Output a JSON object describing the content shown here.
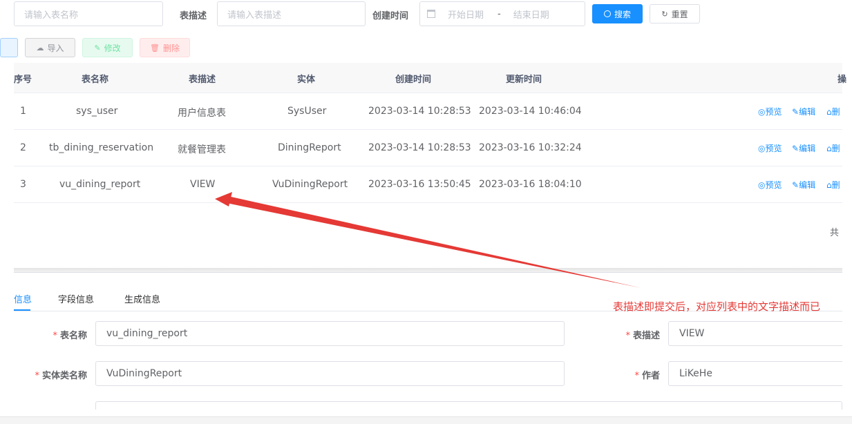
{
  "search": {
    "table_name_placeholder": "请输入表名称",
    "desc_label": "表描述",
    "desc_placeholder": "请输入表描述",
    "created_label": "创建时间",
    "start_placeholder": "开始日期",
    "range_separator": "-",
    "end_placeholder": "结束日期",
    "search_button": "搜索",
    "reset_button": "重置"
  },
  "toolbar": {
    "import_label": "导入",
    "edit_label": "修改",
    "delete_label": "删除"
  },
  "table": {
    "headers": [
      "序号",
      "表名称",
      "表描述",
      "实体",
      "创建时间",
      "更新时间",
      "操"
    ],
    "rows": [
      {
        "index": "1",
        "name": "sys_user",
        "desc": "用户信息表",
        "entity": "SysUser",
        "created": "2023-03-14 10:28:53",
        "updated": "2023-03-14 10:46:04"
      },
      {
        "index": "2",
        "name": "tb_dining_reservation",
        "desc": "就餐管理表",
        "entity": "DiningReport",
        "created": "2023-03-14 10:28:53",
        "updated": "2023-03-16 10:32:24"
      },
      {
        "index": "3",
        "name": "vu_dining_report",
        "desc": "VIEW",
        "entity": "VuDiningReport",
        "created": "2023-03-16 13:50:45",
        "updated": "2023-03-16 18:04:10"
      }
    ],
    "actions": {
      "preview": "预览",
      "edit": "编辑",
      "delete": "删"
    }
  },
  "pagination": {
    "total_prefix": "共"
  },
  "tabs": [
    "信息",
    "字段信息",
    "生成信息"
  ],
  "form": {
    "table_name_label": "表名称",
    "table_name_value": "vu_dining_report",
    "table_desc_label": "表描述",
    "table_desc_value": "VIEW",
    "class_name_label": "实体类名称",
    "class_name_value": "VuDiningReport",
    "author_label": "作者",
    "author_value": "LiKeHe"
  },
  "annotation": {
    "text": "表描述即提交后，对应列表中的文字描述而已",
    "color": "#e53935"
  },
  "colors": {
    "primary": "#1890ff",
    "success_light": "#e7faf0",
    "danger_light": "#ffeded",
    "border": "#dcdfe6"
  }
}
